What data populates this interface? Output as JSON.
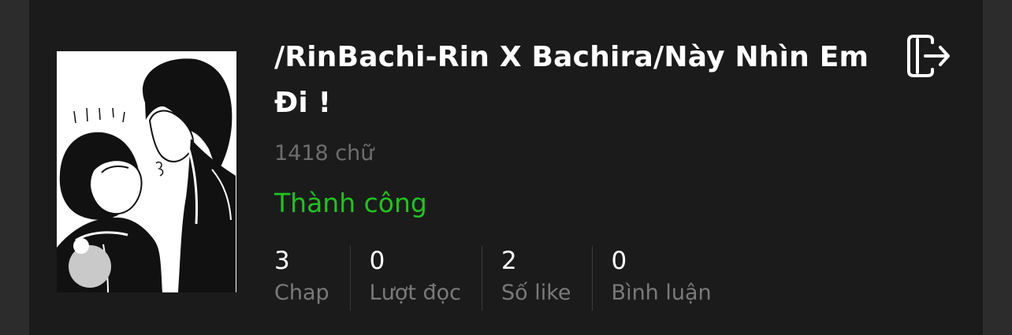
{
  "story": {
    "title": "/RinBachi-Rin X Bachira/Này Nhìn Em Đi !",
    "word_count": "1418 chữ",
    "status": "Thành công",
    "cover_alt": "anime-style black and white illustration of two characters"
  },
  "stats": [
    {
      "value": "3",
      "label": "Chap"
    },
    {
      "value": "0",
      "label": "Lượt đọc"
    },
    {
      "value": "2",
      "label": "Số like"
    },
    {
      "value": "0",
      "label": "Bình luận"
    }
  ],
  "actions": {
    "exit_icon": "exit-icon"
  },
  "colors": {
    "background": "#2c2c2c",
    "card": "#1b1b1b",
    "title": "#ffffff",
    "muted": "#6d6d6d",
    "status": "#1fc41f"
  }
}
